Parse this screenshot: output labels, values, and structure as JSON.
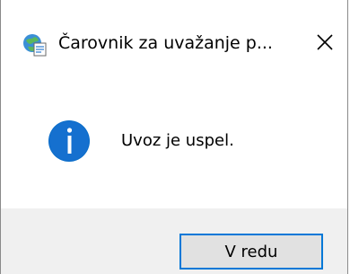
{
  "dialog": {
    "title": "Čarovnik za uvažanje p...",
    "app_icon": "certificate-wizard-icon",
    "close_icon": "close-icon",
    "message_icon": "info-icon",
    "message": "Uvoz je uspel.",
    "ok_label": "V redu"
  },
  "colors": {
    "accent": "#0078d7",
    "info_blue": "#0a6dc9",
    "footer_bg": "#f0f0f0",
    "button_bg": "#e1e1e1"
  }
}
